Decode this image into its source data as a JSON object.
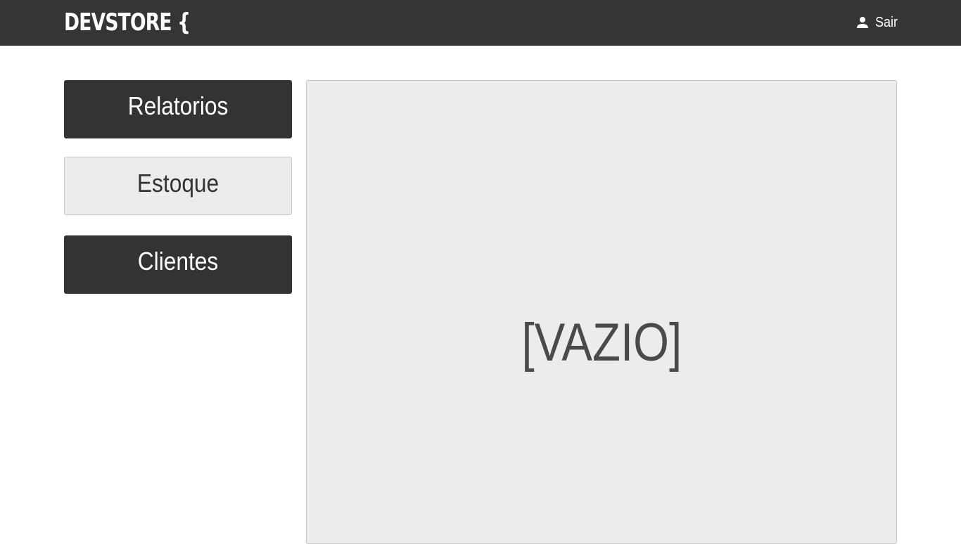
{
  "header": {
    "logo_text": "DEVSTORE {",
    "logout_label": "Sair",
    "logout_icon": "person-icon",
    "background_color": "#353535"
  },
  "sidebar": {
    "items": [
      {
        "label": "Relatorios",
        "style": "dark"
      },
      {
        "label": "Estoque",
        "style": "light"
      },
      {
        "label": "Clientes",
        "style": "dark"
      }
    ]
  },
  "main": {
    "empty_message": "[VAZIO]"
  },
  "colors": {
    "dark": "#333333",
    "light_panel": "#ececec",
    "text_gray": "#4a4a4a"
  }
}
